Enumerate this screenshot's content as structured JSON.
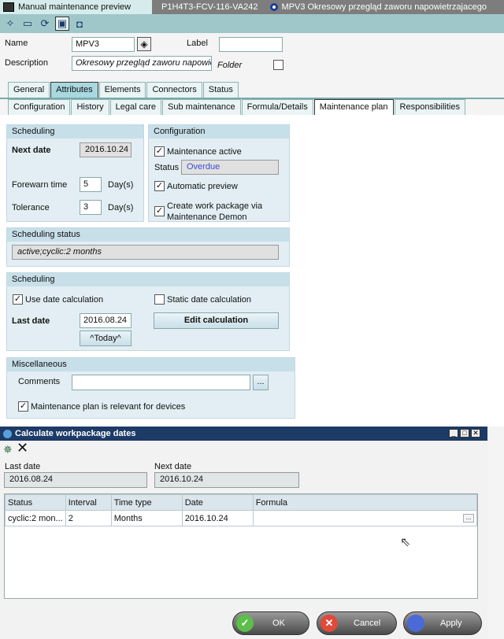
{
  "titlebar": {
    "tab1": "Manual maintenance preview",
    "tab2": "P1H4T3-FCV-116-VA242",
    "tab3": "MPV3  Okresowy przegląd zaworu napowietrzajacego"
  },
  "header": {
    "name_label": "Name",
    "name_value": "MPV3",
    "label_label": "Label",
    "label_value": "",
    "description_label": "Description",
    "description_value": "Okresowy przegląd zaworu napowietrz",
    "folder_label": "Folder",
    "folder_checked": false
  },
  "tabs_main": [
    "General",
    "Attributes",
    "Elements",
    "Connectors",
    "Status"
  ],
  "tabs_sub": [
    "Configuration",
    "History",
    "Legal care",
    "Sub maintenance",
    "Formula/Details",
    "Maintenance plan",
    "Responsibilities"
  ],
  "scheduling1": {
    "title": "Scheduling",
    "next_date_label": "Next date",
    "next_date": "2016.10.24",
    "forewarn_label": "Forewarn time",
    "forewarn_value": "5",
    "forewarn_unit": "Day(s)",
    "tolerance_label": "Tolerance",
    "tolerance_value": "3",
    "tolerance_unit": "Day(s)"
  },
  "configuration": {
    "title": "Configuration",
    "maint_active": "Maintenance active",
    "status_label": "Status",
    "status_value": "Overdue",
    "auto_preview": "Automatic preview",
    "create_wp_1": "Create work package via",
    "create_wp_2": "Maintenance Demon"
  },
  "sched_status": {
    "title": "Scheduling status",
    "value": "active;cyclic:2 months"
  },
  "scheduling2": {
    "title": "Scheduling",
    "use_date_calc": "Use date calculation",
    "static_date_calc": "Static date calculation",
    "last_date_label": "Last date",
    "last_date": "2016.08.24",
    "edit_calc": "Edit calculation",
    "today": "^Today^"
  },
  "misc": {
    "title": "Miscellaneous",
    "comments_label": "Comments",
    "comments_value": "",
    "browse": "...",
    "relevant": "Maintenance plan is relevant for devices"
  },
  "dialog": {
    "title": "Calculate workpackage dates",
    "last_date_label": "Last date",
    "last_date": "2016.08.24",
    "next_date_label": "Next date",
    "next_date": "2016.10.24",
    "columns": [
      "Status",
      "Interval",
      "Time type",
      "Date",
      "Formula"
    ],
    "row": {
      "status": "cyclic:2 mon...",
      "interval": "2",
      "time_type": "Months",
      "date": "2016.10.24",
      "formula": ""
    },
    "ok": "OK",
    "cancel": "Cancel",
    "apply": "Apply"
  }
}
